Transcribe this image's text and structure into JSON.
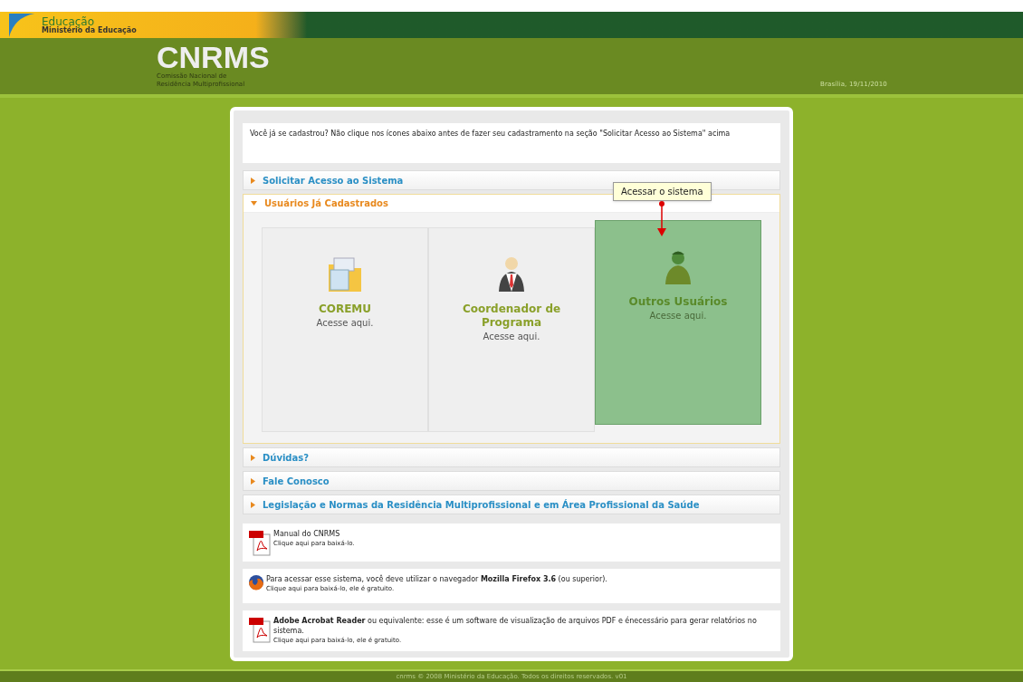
{
  "gov_bar": {
    "title": "Educação",
    "subtitle": "Ministério da Educação"
  },
  "header": {
    "logo": "CNRMS",
    "subtitle_lines": [
      "Comissão Nacional de",
      "Residência Multiprofissional"
    ],
    "date": "Brasília, 19/11/2010"
  },
  "intro": "Você já se cadastrou? Não clique nos ícones abaixo antes de fazer seu cadastramento na seção \"Solicitar Acesso ao Sistema\" acima",
  "sections": [
    {
      "label": "Solicitar Acesso ao Sistema",
      "expanded": false
    },
    {
      "label": "Usuários Já Cadastrados",
      "expanded": true,
      "tooltip": "Acessar o sistema",
      "tiles": [
        {
          "kind": "folder",
          "title": "COREMU",
          "link": "Acesse aqui.",
          "selected": false
        },
        {
          "kind": "coordinator",
          "title": "Coordenador de Programa",
          "link": "Acesse aqui.",
          "selected": false
        },
        {
          "kind": "user",
          "title": "Outros Usuários",
          "link": "Acesse aqui.",
          "selected": true
        }
      ]
    },
    {
      "label": "Dúvidas?",
      "expanded": false
    },
    {
      "label": "Fale Conosco",
      "expanded": false
    },
    {
      "label": "Legislação e Normas da Residência Multiprofissional e em Área Profissional da Saúde",
      "expanded": false
    }
  ],
  "notices": [
    {
      "kind": "pdf",
      "text": "Manual do CNRMS",
      "link": "Clique aqui para baixá-lo."
    },
    {
      "kind": "firefox",
      "text": "Para acessar esse sistema, você deve utilizar o navegador **Mozilla Firefox 3.6** (ou superior).",
      "link": "Clique aqui para baixá-lo, ele é gratuito."
    },
    {
      "kind": "pdf",
      "text": "**Adobe Acrobat Reader** ou equivalente: esse é um software de visualização de arquivos PDF e énecessário para gerar relatórios no sistema.",
      "link": "Clique aqui para baixá-lo, ele é gratuito."
    }
  ],
  "footer": "cnrms © 2008 Ministério da Educação. Todos os direitos reservados. v01"
}
